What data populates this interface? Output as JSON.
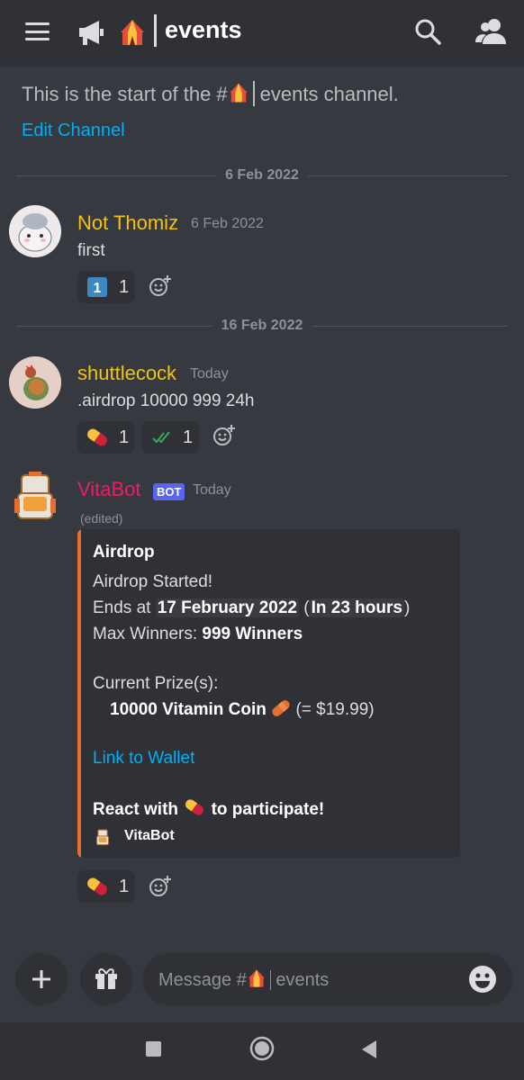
{
  "header": {
    "channel_name": "events",
    "icons": [
      "menu-icon",
      "announcement-icon",
      "circus-tent-emoji",
      "search-icon",
      "members-icon"
    ]
  },
  "intro": {
    "text_before": "This is the start of the #",
    "text_after": "events channel.",
    "edit_link": "Edit Channel"
  },
  "dividers": [
    "6 Feb 2022",
    "16 Feb 2022"
  ],
  "messages": [
    {
      "author": "Not Thomiz",
      "time": "6 Feb 2022",
      "content": "first",
      "author_color": "#f1c40f",
      "reactions": [
        {
          "emoji": "keycap-1",
          "count": "1"
        }
      ]
    },
    {
      "author": "shuttlecock",
      "time": "Today",
      "content": ".airdrop 10000 999 24h",
      "author_color": "#f1c40f",
      "reactions": [
        {
          "emoji": "pill",
          "count": "1"
        },
        {
          "emoji": "double-check",
          "count": "1"
        }
      ]
    },
    {
      "author": "VitaBot",
      "badge": "BOT",
      "time": "Today",
      "edited": "(edited)",
      "author_color": "#e91e63",
      "embed": {
        "title": "Airdrop",
        "line1": "Airdrop Started!",
        "ends_prefix": "Ends at ",
        "ends_date": "17 February 2022",
        "ends_rel": "In 23 hours",
        "winners_prefix": "Max Winners: ",
        "winners_value": "999 Winners",
        "prize_label": "Current Prize(s):",
        "prize_value": "10000 Vitamin Coin",
        "prize_usd": "(= $19.99)",
        "link": "Link to Wallet",
        "react_prefix": "React with",
        "react_suffix": "to participate!",
        "footer": "VitaBot",
        "accent": "#e66e2e"
      },
      "reactions": [
        {
          "emoji": "pill",
          "count": "1"
        }
      ]
    }
  ],
  "composer": {
    "placeholder_prefix": "Message #",
    "placeholder_channel": "events"
  },
  "colors": {
    "background": "#36393f",
    "panel": "#2f3136",
    "link": "#00aff4",
    "bot_badge": "#5865f2"
  }
}
